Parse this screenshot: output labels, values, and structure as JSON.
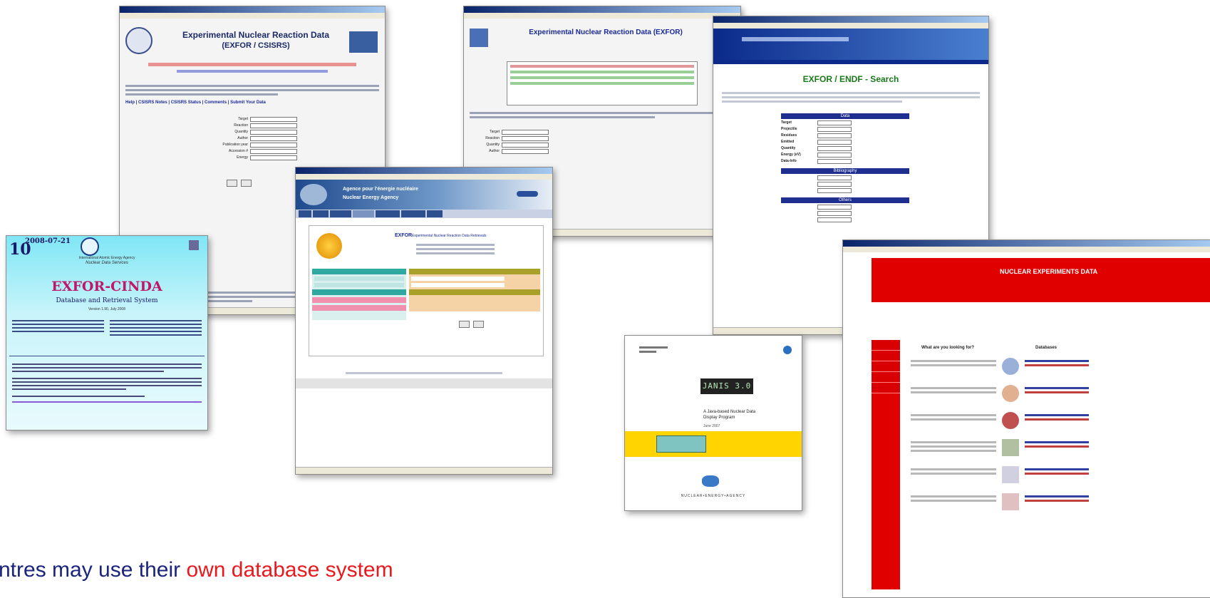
{
  "caption": {
    "prefix": "ntres may use their ",
    "highlight": "own database system"
  },
  "colors": {
    "caption_blue": "#1a237e",
    "caption_red": "#e8191e",
    "windows_title": "#0a246a",
    "nea_red": "#e00000",
    "cinda_cyan": "#bff2f8"
  },
  "win_exfor_csisrs": {
    "title": "Experimental Nuclear Reaction Data",
    "subtitle": "(EXFOR / CSISRS)",
    "nav": "Help | CSISRS Notes | CSISRS Status | Comments | Submit Your Data"
  },
  "win_jaea_exfor": {
    "title": "Experimental Nuclear Reaction Data (EXFOR)"
  },
  "win_jcprg": {
    "title": "EXFOR / ENDF - Search",
    "fields": [
      "Target",
      "Projectile",
      "Residues",
      "Emitted",
      "Quantity",
      "Energy (eV)",
      "Data-Info"
    ],
    "section_headers": [
      "Data",
      "Bibliography",
      "Others"
    ]
  },
  "win_nea": {
    "title_line1": "Agence pour l'énergie nucléaire",
    "title_line2": "Nuclear Energy Agency",
    "exfor_heading": "EXFOR",
    "exfor_sub": "Experimental Nuclear Reaction Data Retrievals"
  },
  "win_cinda": {
    "number": "10",
    "date": "2008-07-21",
    "org": "International Atomic Energy Agency",
    "service": "Nuclear Data Services",
    "title": "EXFOR-CINDA",
    "subtitle": "Database and Retrieval System",
    "version": "Version 1.90, July 2008"
  },
  "win_janis": {
    "brand": "JANIS 3.0",
    "desc_line1": "A Java-based Nuclear Data",
    "desc_line2": "Display Program",
    "date": "June 2007",
    "footer": "NUCLEAR•ENERGY•AGENCY"
  },
  "win_nea_red": {
    "banner": "NUCLEAR EXPERIMENTS DATA",
    "col1": "What are you looking for?",
    "col2": "Databases"
  }
}
